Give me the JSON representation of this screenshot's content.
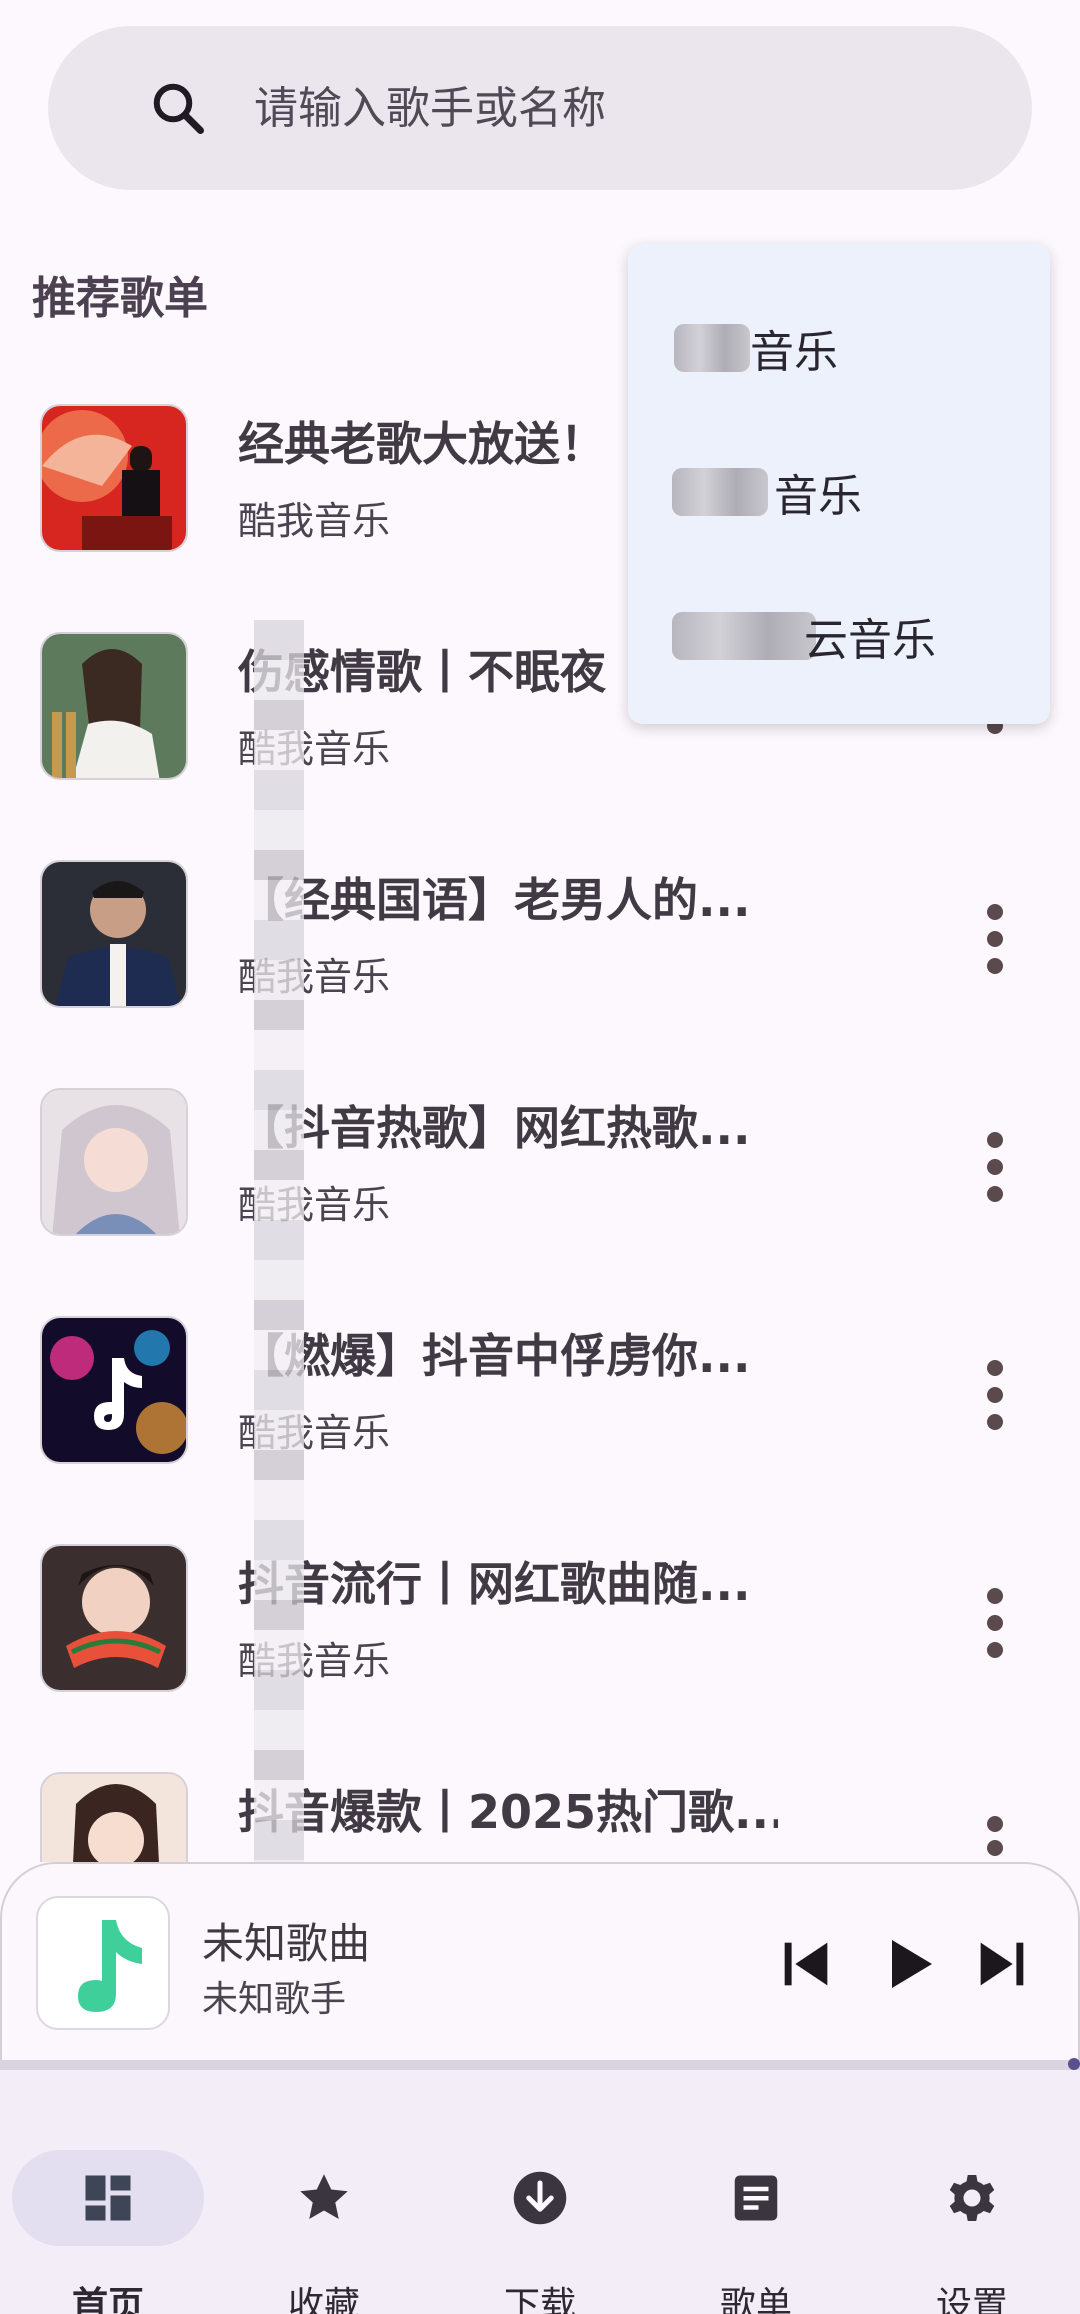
{
  "search": {
    "placeholder": "请输入歌手或名称",
    "icon": "search-icon"
  },
  "section_title": "推荐歌单",
  "playlists": [
    {
      "title": "经典老歌大放送！",
      "source": "酷我音乐"
    },
    {
      "title": "伤感情歌丨不眠夜",
      "source": "酷我音乐"
    },
    {
      "title": "【经典国语】老男人的...",
      "source": "酷我音乐"
    },
    {
      "title": "【抖音热歌】网红热歌...",
      "source": "酷我音乐"
    },
    {
      "title": "【燃爆】抖音中俘虏你...",
      "source": "酷我音乐"
    },
    {
      "title": "抖音流行丨网红歌曲随...",
      "source": "酷我音乐"
    },
    {
      "title": "抖音爆款丨2025热门歌...",
      "source": ""
    }
  ],
  "menu": {
    "items": [
      {
        "label": "音乐"
      },
      {
        "label": "音乐"
      },
      {
        "label": "云音乐"
      }
    ]
  },
  "player": {
    "title": "未知歌曲",
    "artist": "未知歌手",
    "progress": 0.99
  },
  "nav": {
    "items": [
      {
        "label": "首页",
        "icon": "home-dashboard-icon",
        "active": true
      },
      {
        "label": "收藏",
        "icon": "star-icon",
        "active": false
      },
      {
        "label": "下载",
        "icon": "download-icon",
        "active": false
      },
      {
        "label": "歌单",
        "icon": "playlist-icon",
        "active": false
      },
      {
        "label": "设置",
        "icon": "gear-icon",
        "active": false
      }
    ]
  },
  "colors": {
    "background": "#fcf8fd",
    "accent_green": "#3ecf9a",
    "nav_active_pill": "#e3def0",
    "menu_background": "#edf1fc"
  }
}
